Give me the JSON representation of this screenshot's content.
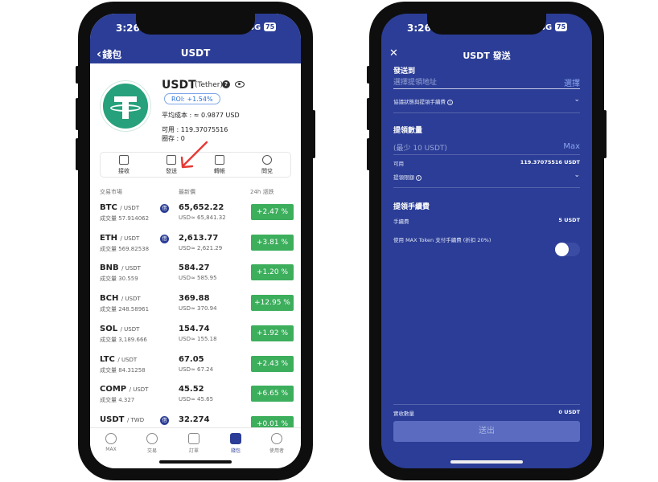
{
  "status_bar": {
    "time": "3:26",
    "network": "4G",
    "battery": "75"
  },
  "left": {
    "back_label": "錢包",
    "title": "USDT",
    "coin": {
      "symbol": "USDT",
      "full_name": "(Tether)",
      "roi": "ROI: +1.54%",
      "avg_cost": "平均成本 : ≈ 0.9877 USD",
      "available": "可用 : 119.37075516",
      "locked": "圈存 : 0"
    },
    "actions": [
      {
        "label": "接收",
        "icon": "receive-icon"
      },
      {
        "label": "發送",
        "icon": "send-icon"
      },
      {
        "label": "轉帳",
        "icon": "transfer-icon"
      },
      {
        "label": "問兌",
        "icon": "exchange-icon"
      }
    ],
    "market_header": {
      "market": "交易市場",
      "price": "最新價",
      "change": "24h 漲跌"
    },
    "rows": [
      {
        "base": "BTC",
        "quote": "/ USDT",
        "volume": "成交量 57.914062",
        "price": "65,652.22",
        "usd": "USD≈ 65,841.32",
        "change": "+2.47 %",
        "badge": "借"
      },
      {
        "base": "ETH",
        "quote": "/ USDT",
        "volume": "成交量 569.82538",
        "price": "2,613.77",
        "usd": "USD≈ 2,621.29",
        "change": "+3.81 %",
        "badge": "借"
      },
      {
        "base": "BNB",
        "quote": "/ USDT",
        "volume": "成交量 30.559",
        "price": "584.27",
        "usd": "USD≈ 585.95",
        "change": "+1.20 %",
        "badge": ""
      },
      {
        "base": "BCH",
        "quote": "/ USDT",
        "volume": "成交量 248.58961",
        "price": "369.88",
        "usd": "USD≈ 370.94",
        "change": "+12.95 %",
        "badge": ""
      },
      {
        "base": "SOL",
        "quote": "/ USDT",
        "volume": "成交量 3,189.666",
        "price": "154.74",
        "usd": "USD≈ 155.18",
        "change": "+1.92 %",
        "badge": ""
      },
      {
        "base": "LTC",
        "quote": "/ USDT",
        "volume": "成交量 84.31258",
        "price": "67.05",
        "usd": "USD≈ 67.24",
        "change": "+2.43 %",
        "badge": ""
      },
      {
        "base": "COMP",
        "quote": "/ USDT",
        "volume": "成交量 4.327",
        "price": "45.52",
        "usd": "USD≈ 45.65",
        "change": "+6.65 %",
        "badge": ""
      },
      {
        "base": "USDT",
        "quote": "/ TWD",
        "volume": "",
        "price": "32.274",
        "usd": "",
        "change": "+0.01 %",
        "badge": "借"
      }
    ],
    "tabs": [
      {
        "label": "MAX",
        "icon": "max-icon"
      },
      {
        "label": "交易",
        "icon": "trade-icon"
      },
      {
        "label": "訂單",
        "icon": "orders-icon"
      },
      {
        "label": "錢包",
        "icon": "wallet-icon",
        "active": true
      },
      {
        "label": "使用者",
        "icon": "user-icon"
      }
    ]
  },
  "right": {
    "title": "USDT 發送",
    "send_to_label": "發送到",
    "address_placeholder": "選擇提領地址",
    "select_link": "選擇",
    "protocol_label": "協議狀態與提領手續費",
    "amount_label": "提領數量",
    "amount_placeholder": "(最少 10 USDT)",
    "max_link": "Max",
    "available_label": "可用",
    "available_value": "119.37075516 USDT",
    "limit_label": "提領限額",
    "fee_section_label": "提領手續費",
    "fee_label": "手續費",
    "fee_value": "5 USDT",
    "max_token_label": "使用 MAX Token 支付手續費 (折扣 20%)",
    "received_label": "實收數量",
    "received_value": "0 USDT",
    "submit_label": "送出"
  },
  "colors": {
    "brand": "#2b3d96",
    "positive": "#3cae5c",
    "tether": "#26a17b",
    "annotation_arrow": "#e53935"
  }
}
